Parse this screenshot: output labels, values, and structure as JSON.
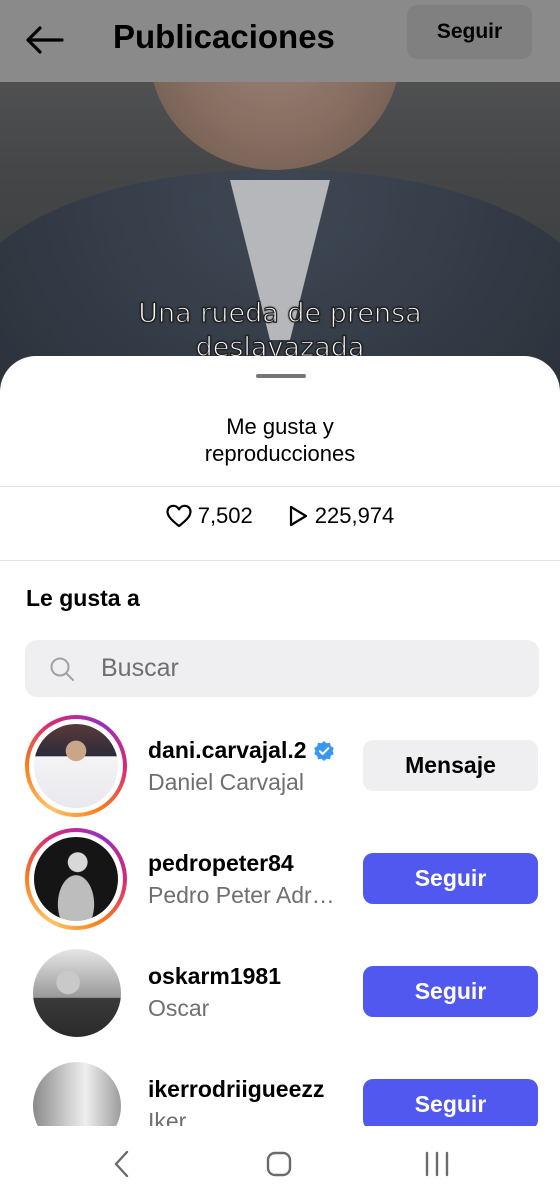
{
  "header": {
    "title": "Publicaciones",
    "follow_label": "Seguir"
  },
  "video": {
    "caption_line1": "Una rueda de prensa",
    "caption_line2": "deslavazada"
  },
  "sheet": {
    "title_line1": "Me gusta y",
    "title_line2": "reproducciones",
    "likes": "7,502",
    "plays": "225,974",
    "section_title": "Le gusta a",
    "search_placeholder": "Buscar"
  },
  "users": [
    {
      "username": "dani.carvajal.2",
      "fullname": "Daniel Carvajal",
      "verified": true,
      "story_ring": true,
      "action": "Mensaje"
    },
    {
      "username": "pedropeter84",
      "fullname": "Pedro Peter Adr…",
      "verified": false,
      "story_ring": true,
      "action": "Seguir"
    },
    {
      "username": "oskarm1981",
      "fullname": "Oscar",
      "verified": false,
      "story_ring": false,
      "action": "Seguir"
    },
    {
      "username": "ikerrodriigueezz",
      "fullname": "Iker",
      "verified": false,
      "story_ring": false,
      "action": "Seguir"
    }
  ],
  "icons": {
    "back": "arrow-left-icon",
    "heart": "heart-icon",
    "play": "play-icon",
    "search": "search-icon",
    "verified": "verified-badge-icon",
    "nav_back": "chevron-left-icon",
    "nav_home": "home-square-icon",
    "nav_recents": "recents-icon"
  },
  "colors": {
    "follow_button": "#5058f0",
    "verified": "#3897f0"
  }
}
